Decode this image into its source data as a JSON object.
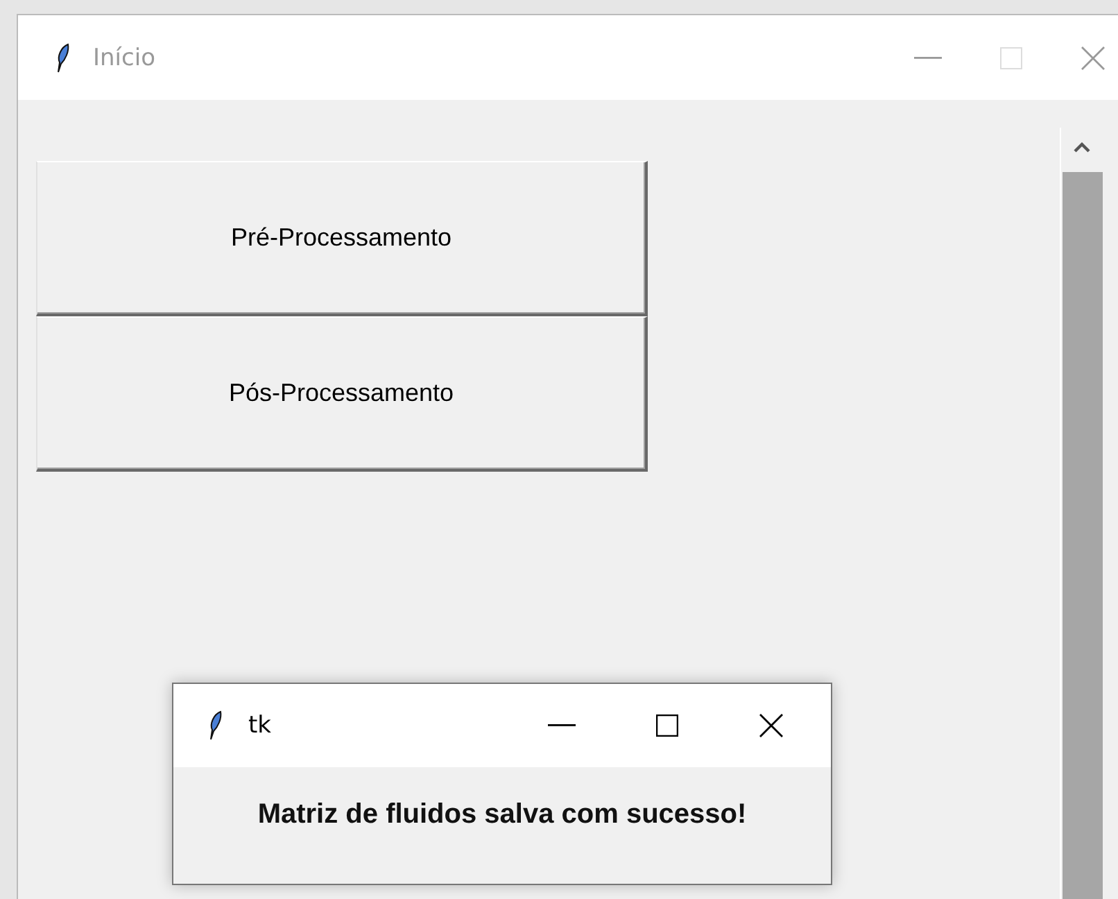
{
  "window": {
    "title": "Início",
    "active": false
  },
  "buttons": [
    {
      "label": "Pré-Processamento"
    },
    {
      "label": "Pós-Processamento"
    }
  ],
  "dialog": {
    "title": "tk",
    "message": "Matriz de fluidos salva com sucesso!"
  }
}
